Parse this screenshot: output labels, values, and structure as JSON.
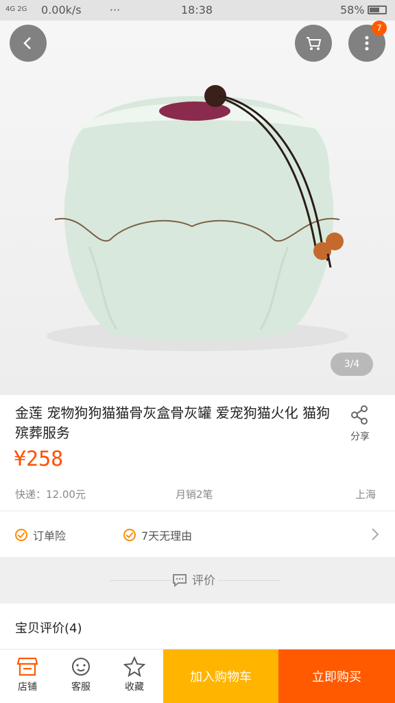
{
  "status_bar": {
    "network": "4G 2G",
    "speed": "0.00k/s",
    "more": "···",
    "time": "18:38",
    "battery": "58%"
  },
  "header": {
    "cart_badge": "7"
  },
  "gallery": {
    "pager": "3/4"
  },
  "product": {
    "title": "金莲 宠物狗狗猫猫骨灰盒骨灰罐 爱宠狗猫火化 猫狗殡葬服务",
    "share_label": "分享",
    "price": "¥258",
    "shipping": "快递：12.00元",
    "monthly_sales": "月销2笔",
    "location": "上海"
  },
  "guarantees": {
    "item1": "订单险",
    "item2": "7天无理由"
  },
  "reviews": {
    "divider_label": "评价",
    "section_title": "宝贝评价(4)"
  },
  "bottom_bar": {
    "shop": "店铺",
    "service": "客服",
    "favorite": "收藏",
    "add_to_cart": "加入购物车",
    "buy_now": "立即购买"
  },
  "colors": {
    "accent": "#ff5000",
    "cart_button": "#ffb400",
    "buy_button": "#ff5a00"
  }
}
